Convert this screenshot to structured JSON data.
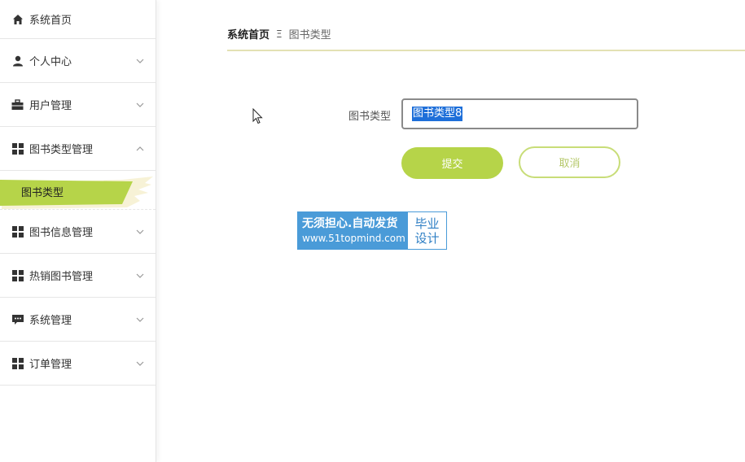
{
  "sidebar": {
    "items": [
      {
        "label": "系统首页",
        "icon": "home-icon"
      },
      {
        "label": "个人中心",
        "icon": "user-icon"
      },
      {
        "label": "用户管理",
        "icon": "briefcase-icon"
      },
      {
        "label": "图书类型管理",
        "icon": "grid-icon",
        "expanded": true,
        "children": [
          {
            "label": "图书类型",
            "active": true
          }
        ]
      },
      {
        "label": "图书信息管理",
        "icon": "grid-icon"
      },
      {
        "label": "热销图书管理",
        "icon": "grid-icon"
      },
      {
        "label": "系统管理",
        "icon": "chat-icon"
      },
      {
        "label": "订单管理",
        "icon": "grid-icon"
      }
    ]
  },
  "breadcrumb": {
    "home": "系统首页",
    "separator": "Ξ",
    "current": "图书类型"
  },
  "form": {
    "label": "图书类型",
    "value": "图书类型8",
    "submit_label": "提交",
    "cancel_label": "取消"
  },
  "watermark": {
    "line1": "无须担心.自动发货",
    "line2": "www.51topmind.com",
    "right1": "毕业",
    "right2": "设计"
  },
  "colors": {
    "accent": "#b6d449",
    "selection": "#1e6fd9",
    "watermark_blue": "#4a9bd8"
  }
}
